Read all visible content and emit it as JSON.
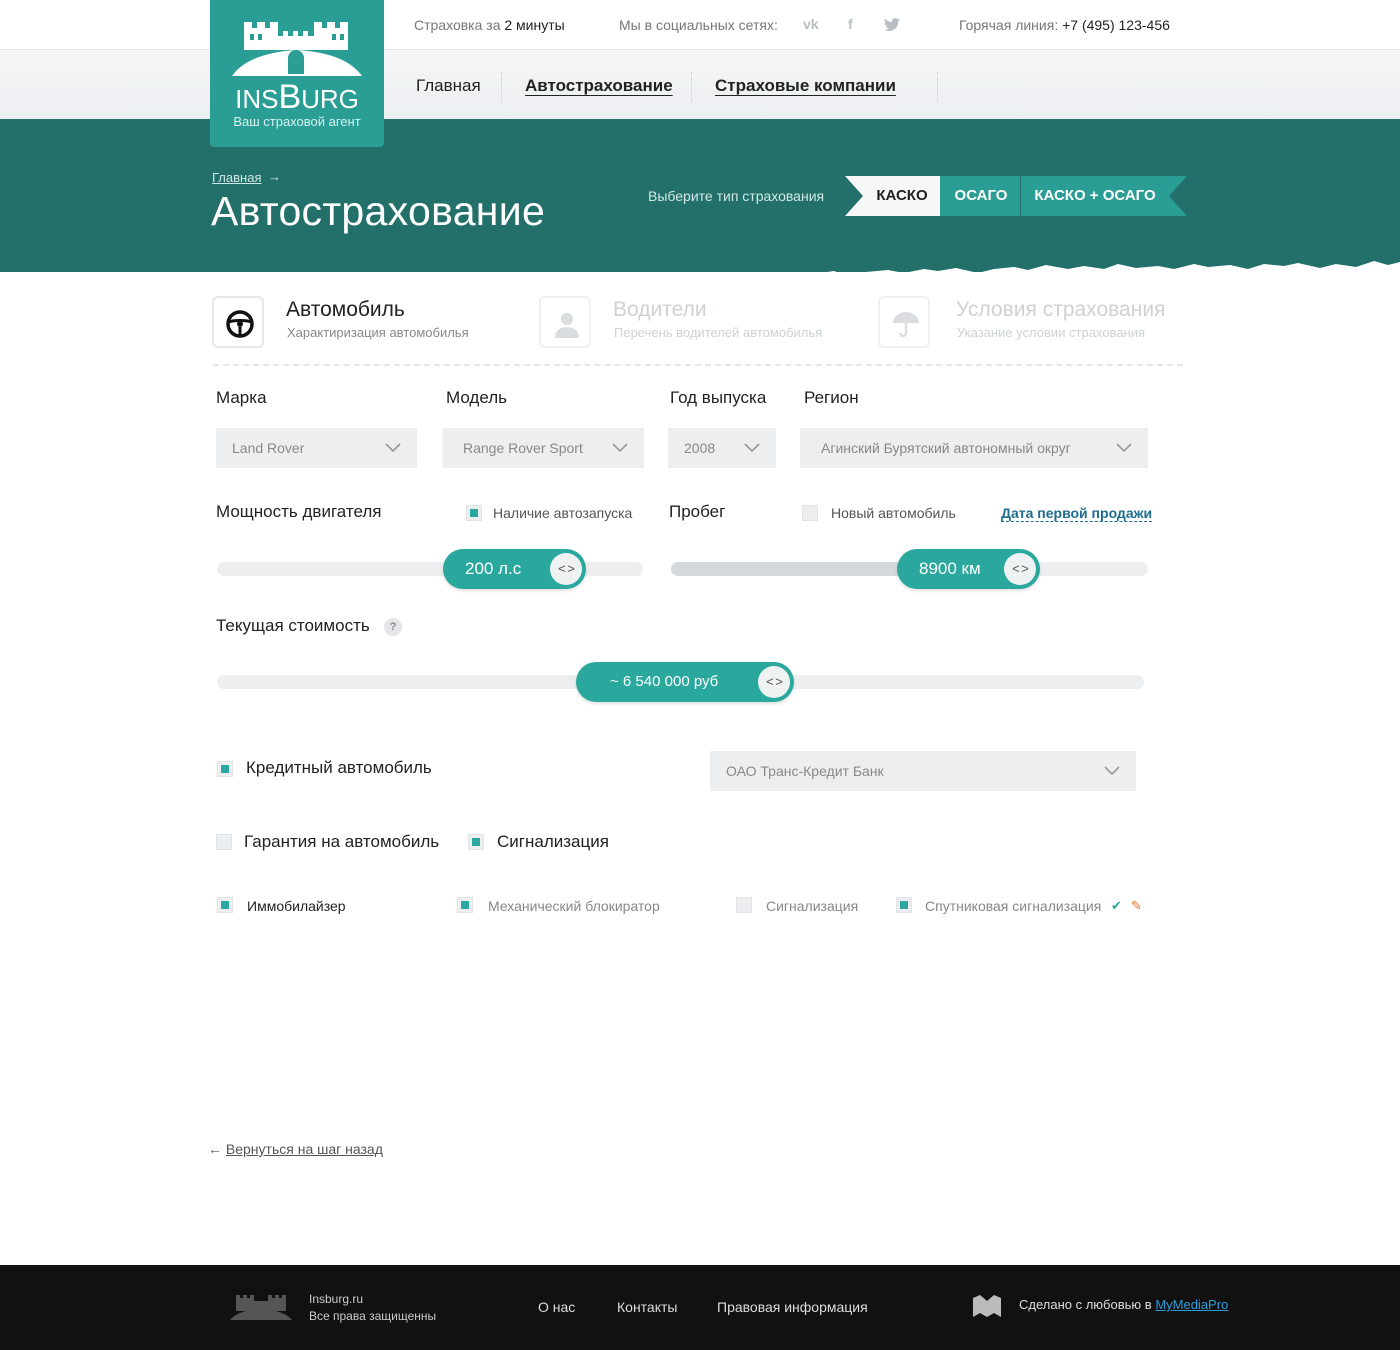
{
  "topbar": {
    "insurance_prefix": "Страховка за",
    "insurance_time": "2 минуты",
    "social_label": "Мы в социальных сетях:",
    "social": [
      "vk-icon",
      "facebook-icon",
      "twitter-icon"
    ],
    "hotline_label": "Горячая линия:",
    "hotline_phone": "+7 (495) 123-456"
  },
  "logo": {
    "name_pre": "INS",
    "name_big": "B",
    "name_post": "URG",
    "tagline": "Ваш страховой агент"
  },
  "nav": {
    "items": [
      "Главная",
      "Автострахование",
      "Страховые компании"
    ],
    "active": "Автострахование"
  },
  "hero": {
    "breadcrumb": "Главная",
    "title": "Автострахование",
    "choose_label": "Выберите тип страхования",
    "types": [
      "КАСКО",
      "ОСАГО",
      "КАСКО + ОСАГО"
    ],
    "selected_type": "КАСКО"
  },
  "steps": [
    {
      "title": "Автомобиль",
      "subtitle": "Характиризация автомобилья",
      "icon": "steering-wheel-icon",
      "active": true
    },
    {
      "title": "Водители",
      "subtitle": "Перечень водителей автомобилья",
      "icon": "driver-icon",
      "active": false
    },
    {
      "title": "Условия страхования",
      "subtitle": "Указание условии страхования",
      "icon": "umbrella-icon",
      "active": false
    }
  ],
  "form": {
    "brand": {
      "label": "Марка",
      "value": "Land Rover"
    },
    "model": {
      "label": "Модель",
      "value": "Range Rover Sport"
    },
    "year": {
      "label": "Год выпуска",
      "value": "2008"
    },
    "region": {
      "label": "Регион",
      "value": "Агинский Бурятский автономный округ"
    },
    "power": {
      "label": "Мощность двигателя",
      "value": "200 л.с",
      "position": 0.55
    },
    "autostart": {
      "label": "Наличие автозапуска",
      "checked": true
    },
    "mileage": {
      "label": "Пробег",
      "value": "8900 км",
      "position": 0.62
    },
    "new_car": {
      "label": "Новый автомобиль",
      "checked": false
    },
    "first_sale_link": "Дата первой продажи",
    "cost": {
      "label": "Текущая стоимость",
      "help": "?",
      "value": "~ 6 540 000 руб",
      "position": 0.52
    },
    "credit": {
      "label": "Кредитный автомобиль",
      "checked": true
    },
    "bank": {
      "value": "ОАО Транс-Кредит Банк"
    },
    "guarantee": {
      "label": "Гарантия на автомобиль",
      "checked": false
    },
    "alarm": {
      "label": "Сигнализация",
      "checked": true
    },
    "devices": [
      {
        "label": "Иммобилайзер",
        "checked": true
      },
      {
        "label": "Механический блокиратор",
        "checked": true
      },
      {
        "label": "Сигнализация",
        "checked": false
      },
      {
        "label": "Спутниковая сигнализация",
        "checked": true
      }
    ]
  },
  "back_link": "Вернуться на шаг назад",
  "footer": {
    "site": "Insburg.ru",
    "rights": "Все права защищенны",
    "links": [
      "О нас",
      "Контакты",
      "Правовая информация"
    ],
    "made_with": "Сделано с любовью в",
    "studio": "MyMediaPro"
  },
  "colors": {
    "teal": "#2aa89e",
    "dark_teal": "#23706b",
    "footer": "#111111"
  }
}
